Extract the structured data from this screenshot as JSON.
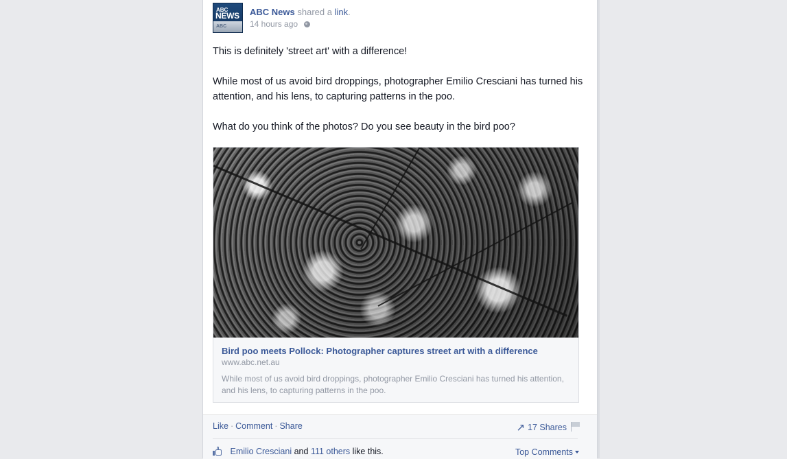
{
  "post": {
    "page_name": "ABC News",
    "action_text": "shared a",
    "link_word": "link",
    "period": ".",
    "timestamp": "14 hours ago",
    "avatar": {
      "line1": "ABC",
      "line2": "NEWS",
      "line3": "ABC"
    },
    "body_paragraphs": [
      "This is definitely 'street art' with a difference!",
      "While most of us avoid bird droppings, photographer Emilio Cresciani has turned his attention, and his lens, to capturing patterns in the poo.",
      "What do you think of the photos? Do you see beauty in the bird poo?"
    ]
  },
  "attachment": {
    "title": "Bird poo meets Pollock: Photographer captures street art with a difference",
    "domain": "www.abc.net.au",
    "description": "While most of us avoid bird droppings, photographer Emilio Cresciani has turned his attention, and his lens, to capturing patterns in the poo."
  },
  "actions": {
    "like": "Like",
    "comment": "Comment",
    "share": "Share",
    "separator": "·",
    "shares_count": "17 Shares"
  },
  "likes": {
    "first_liker": "Emilio Cresciani",
    "and_text": "and",
    "others": "111 others",
    "suffix": "like this."
  },
  "comments_sort": {
    "label": "Top Comments"
  },
  "colors": {
    "link_blue": "#3b5998",
    "muted_gray": "#9197a3",
    "page_background": "#e9eaed"
  },
  "icons": [
    "globe-icon",
    "share-arrow-icon",
    "flag-icon",
    "thumbs-up-icon",
    "caret-down-icon"
  ]
}
